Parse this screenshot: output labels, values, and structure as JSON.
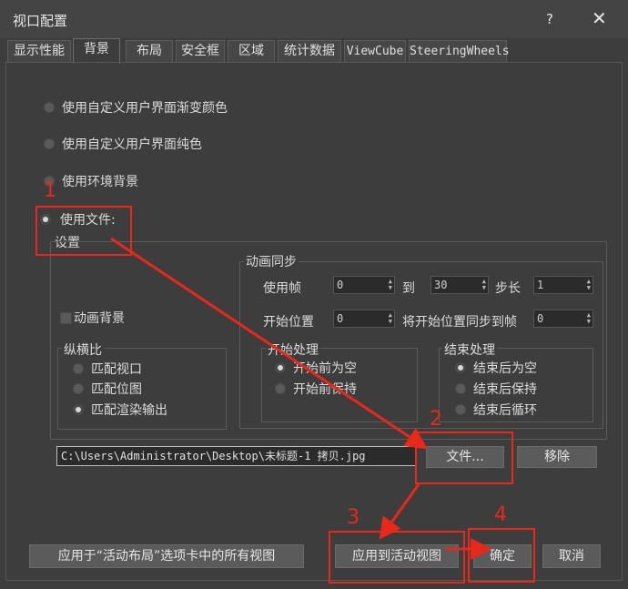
{
  "window": {
    "title": "视口配置",
    "help": "?",
    "close": "✕"
  },
  "tabs": [
    {
      "label": "显示性能"
    },
    {
      "label": "背景"
    },
    {
      "label": "布局"
    },
    {
      "label": "安全框"
    },
    {
      "label": "区域"
    },
    {
      "label": "统计数据"
    },
    {
      "label": "ViewCube"
    },
    {
      "label": "SteeringWheels"
    }
  ],
  "background_options": {
    "gradient": "使用自定义用户界面渐变颜色",
    "solid": "使用自定义用户界面纯色",
    "environment": "使用环境背景",
    "file": "使用文件:",
    "selected": "file"
  },
  "settings_label": "设置",
  "animate_bg_label": "动画背景",
  "aspect": {
    "title": "纵横比",
    "options": [
      "匹配视口",
      "匹配位图",
      "匹配渲染输出"
    ],
    "selected": 2
  },
  "anim_sync": {
    "title": "动画同步",
    "use_frame_label": "使用帧",
    "use_frame_value": "0",
    "to_label": "到",
    "to_value": "30",
    "step_label": "步长",
    "step_value": "1",
    "start_pos_label": "开始位置",
    "start_pos_value": "0",
    "sync_label": "将开始位置同步到帧",
    "sync_value": "0"
  },
  "start_proc": {
    "title": "开始处理",
    "options": [
      "开始前为空",
      "开始前保持"
    ],
    "selected": 0
  },
  "end_proc": {
    "title": "结束处理",
    "options": [
      "结束后为空",
      "结束后保持",
      "结束后循环"
    ],
    "selected": 0
  },
  "file_path": "C:\\Users\\Administrator\\Desktop\\未标题-1 拷贝.jpg",
  "buttons": {
    "file": "文件...",
    "remove": "移除",
    "apply_all": "应用于“活动布局”选项卡中的所有视图",
    "apply_active": "应用到活动视图",
    "ok": "确定",
    "cancel": "取消"
  },
  "annotations": {
    "n1": "1",
    "n2": "2",
    "n3": "3",
    "n4": "4"
  },
  "colors": {
    "annotation": "#e8281a",
    "background": "#3d3d3d"
  }
}
